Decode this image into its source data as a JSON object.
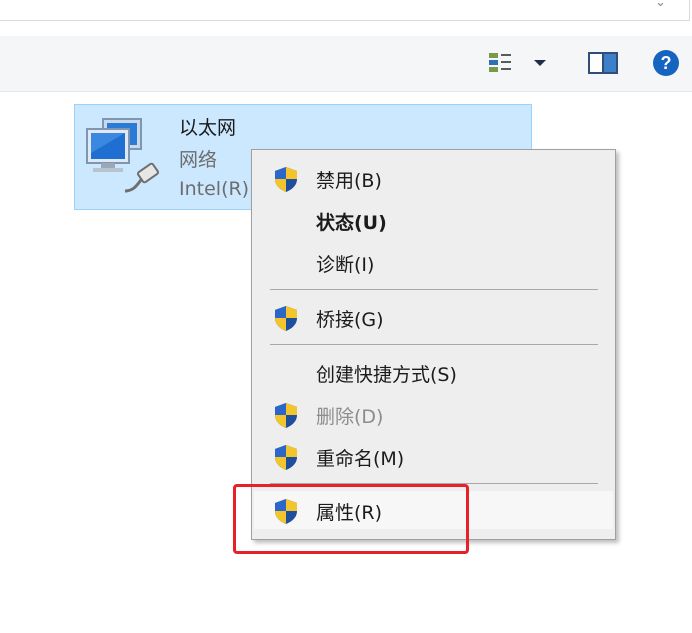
{
  "address_bar": {
    "chevron_icon": "chevron-down-icon"
  },
  "toolbar": {
    "icons": {
      "view": "view-options-icon",
      "view_dropdown": "caret-down-icon",
      "preview_pane": "preview-pane-icon",
      "help": "help-icon"
    },
    "help_label": "?"
  },
  "network_item": {
    "name": "以太网",
    "type": "网络",
    "adapter": "Intel(R)",
    "icon": "network-adapter-icon",
    "selected": true,
    "selection_color": "#cce8ff"
  },
  "context_menu": {
    "items": [
      {
        "label": "禁用(B)",
        "icon": "uac-shield-icon",
        "bold": false,
        "disabled": false
      },
      {
        "label": "状态(U)",
        "icon": null,
        "bold": true,
        "disabled": false
      },
      {
        "label": "诊断(I)",
        "icon": null,
        "bold": false,
        "disabled": false
      },
      {
        "label": "桥接(G)",
        "icon": "uac-shield-icon",
        "bold": false,
        "disabled": false
      },
      {
        "label": "创建快捷方式(S)",
        "icon": null,
        "bold": false,
        "disabled": false
      },
      {
        "label": "删除(D)",
        "icon": "uac-shield-icon",
        "bold": false,
        "disabled": true
      },
      {
        "label": "重命名(M)",
        "icon": "uac-shield-icon",
        "bold": false,
        "disabled": false
      },
      {
        "label": "属性(R)",
        "icon": "uac-shield-icon",
        "bold": false,
        "disabled": false,
        "highlighted": true
      }
    ]
  },
  "annotation": {
    "highlight_color": "#e8202a",
    "target": "属性(R)"
  }
}
